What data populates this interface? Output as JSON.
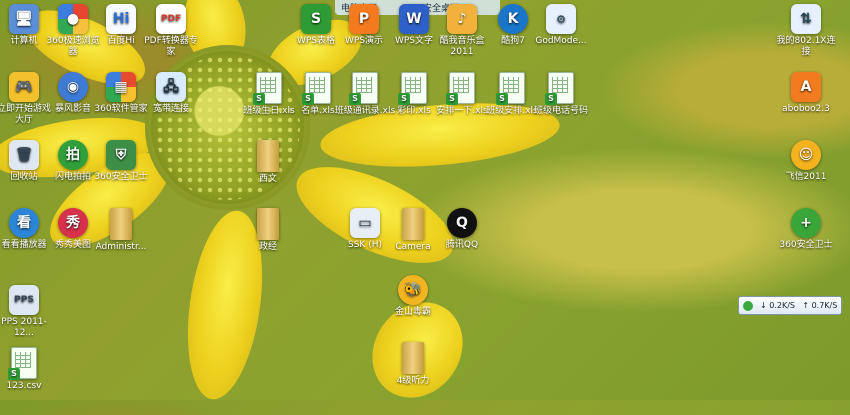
{
  "desktop": {
    "icons": [
      {
        "label": "计算机",
        "icon": "computer-icon",
        "color": "#5a8fd8"
      },
      {
        "label": "360极速浏览器",
        "icon": "browser-icon",
        "color": "#e7452f"
      },
      {
        "label": "百度Hi",
        "icon": "chat-icon",
        "color": "#f7fbff"
      },
      {
        "label": "PDF转换器专家",
        "icon": "pdf-icon",
        "color": "#ffffff"
      },
      {
        "label": "WPS表格",
        "icon": "wps-sheet-icon",
        "color": "#2e9b35"
      },
      {
        "label": "WPS演示",
        "icon": "wps-presentation-icon",
        "color": "#f47a1f"
      },
      {
        "label": "WPS文字",
        "icon": "wps-writer-icon",
        "color": "#2d61c9"
      },
      {
        "label": "酷我音乐盒2011",
        "icon": "music-icon",
        "color": "#f2b13a"
      },
      {
        "label": "酷狗7",
        "icon": "kugou-icon",
        "color": "#1a76c9"
      },
      {
        "label": "GodMode...",
        "icon": "control-panel-icon",
        "color": "#e6f0ff"
      },
      {
        "label": "我的802.1X连接",
        "icon": "network-icon",
        "color": "#e6f0ff"
      },
      {
        "label": "立即开始游戏大厅",
        "icon": "game-icon",
        "color": "#f2c12b"
      },
      {
        "label": "暴风影音",
        "icon": "globe-icon",
        "color": "#3d7bd6"
      },
      {
        "label": "360软件管家",
        "icon": "apps-icon",
        "color": "#e64b2f"
      },
      {
        "label": "宽带连接",
        "icon": "broadband-icon",
        "color": "#d9ecff"
      },
      {
        "label": "班级生日.xls",
        "icon": "xls-icon",
        "color": "#f7fff5"
      },
      {
        "label": "名单.xls",
        "icon": "xls-icon",
        "color": "#f7fff5"
      },
      {
        "label": "班级通讯录.xls",
        "icon": "xls-icon",
        "color": "#f7fff5"
      },
      {
        "label": "彩印.xls",
        "icon": "xls-icon",
        "color": "#f7fff5"
      },
      {
        "label": "安排一下.xls",
        "icon": "xls-icon",
        "color": "#f7fff5"
      },
      {
        "label": "班级安排.xls",
        "icon": "xls-icon",
        "color": "#f7fff5"
      },
      {
        "label": "班级电话号码",
        "icon": "xls-icon",
        "color": "#f7fff5"
      },
      {
        "label": "aboboo2.3",
        "icon": "aboboo-icon",
        "color": "#f37b1f"
      },
      {
        "label": "回收站",
        "icon": "recycle-bin-icon",
        "color": "#dfe8f2"
      },
      {
        "label": "闪电拍拍",
        "icon": "camera-app-icon",
        "color": "#2fa03a"
      },
      {
        "label": "360安全卫士",
        "icon": "shield-app-icon",
        "color": "#3d8f48"
      },
      {
        "label": "西文",
        "icon": "folder-icon",
        "color": "#d9b55c"
      },
      {
        "label": "飞信2011",
        "icon": "fetion-icon",
        "color": "#f5b21f"
      },
      {
        "label": "看看播放器",
        "icon": "player-icon",
        "color": "#2c86d8"
      },
      {
        "label": "秀秀美图",
        "icon": "photo-icon",
        "color": "#d8314b"
      },
      {
        "label": "Administr...",
        "icon": "user-folder-icon",
        "color": "#d9b55c"
      },
      {
        "label": "政经",
        "icon": "folder-icon",
        "color": "#d9b55c"
      },
      {
        "label": "SSK (H)",
        "icon": "drive-icon",
        "color": "#e7eef6"
      },
      {
        "label": "Camera",
        "icon": "folder-icon",
        "color": "#d9b55c"
      },
      {
        "label": "腾讯QQ",
        "icon": "qq-icon",
        "color": "#111111"
      },
      {
        "label": "360安全卫士",
        "icon": "security-icon",
        "color": "#3aa639"
      },
      {
        "label": "PPS 2011-12...",
        "icon": "pps-icon",
        "color": "#dfe8f2"
      },
      {
        "label": "金山毒霸",
        "icon": "bee-icon",
        "color": "#f2b421"
      },
      {
        "label": "123.csv",
        "icon": "csv-icon",
        "color": "#f7fff5"
      },
      {
        "label": "4级听力",
        "icon": "folder-icon",
        "color": "#d9b55c"
      }
    ]
  },
  "top_tabs": {
    "left": "电脑桌面",
    "right": "安全桌面"
  },
  "network_widget": {
    "up": "0.2K/S",
    "down": "0.7K/S"
  }
}
